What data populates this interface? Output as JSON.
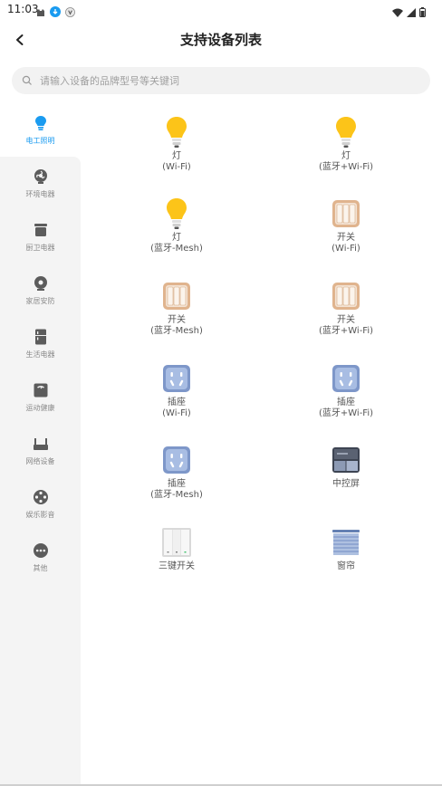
{
  "status_bar": {
    "time": "11:03"
  },
  "header": {
    "title": "支持设备列表"
  },
  "search": {
    "placeholder": "请输入设备的品牌型号等关键词"
  },
  "sidebar": {
    "items": [
      {
        "label": "电工照明",
        "icon": "bulb-icon",
        "active": true
      },
      {
        "label": "环境电器",
        "icon": "fan-icon"
      },
      {
        "label": "厨卫电器",
        "icon": "pot-icon"
      },
      {
        "label": "家居安防",
        "icon": "camera-icon"
      },
      {
        "label": "生活电器",
        "icon": "fridge-icon"
      },
      {
        "label": "运动健康",
        "icon": "scale-icon"
      },
      {
        "label": "网络设备",
        "icon": "router-icon"
      },
      {
        "label": "娱乐影音",
        "icon": "film-reel-icon"
      },
      {
        "label": "其他",
        "icon": "more-icon"
      }
    ]
  },
  "devices": [
    {
      "name": "灯",
      "sub": "(Wi-Fi)",
      "icon": "bulb-icon"
    },
    {
      "name": "灯",
      "sub": "(蓝牙+Wi-Fi)",
      "icon": "bulb-icon"
    },
    {
      "name": "灯",
      "sub": "(蓝牙-Mesh)",
      "icon": "bulb-icon"
    },
    {
      "name": "开关",
      "sub": "(Wi-Fi)",
      "icon": "switch-panel-icon"
    },
    {
      "name": "开关",
      "sub": "(蓝牙-Mesh)",
      "icon": "switch-panel-icon"
    },
    {
      "name": "开关",
      "sub": "(蓝牙+Wi-Fi)",
      "icon": "switch-panel-icon"
    },
    {
      "name": "插座",
      "sub": "(Wi-Fi)",
      "icon": "socket-icon"
    },
    {
      "name": "插座",
      "sub": "(蓝牙+Wi-Fi)",
      "icon": "socket-icon"
    },
    {
      "name": "插座",
      "sub": "(蓝牙-Mesh)",
      "icon": "socket-icon"
    },
    {
      "name": "中控屏",
      "sub": "",
      "icon": "control-screen-icon"
    },
    {
      "name": "三键开关",
      "sub": "",
      "icon": "three-key-switch-icon"
    },
    {
      "name": "窗帘",
      "sub": "",
      "icon": "curtain-icon"
    }
  ],
  "colors": {
    "accent": "#1a9bf0",
    "sidebar_bg": "#f4f4f4",
    "bulb": "#fcc419"
  }
}
